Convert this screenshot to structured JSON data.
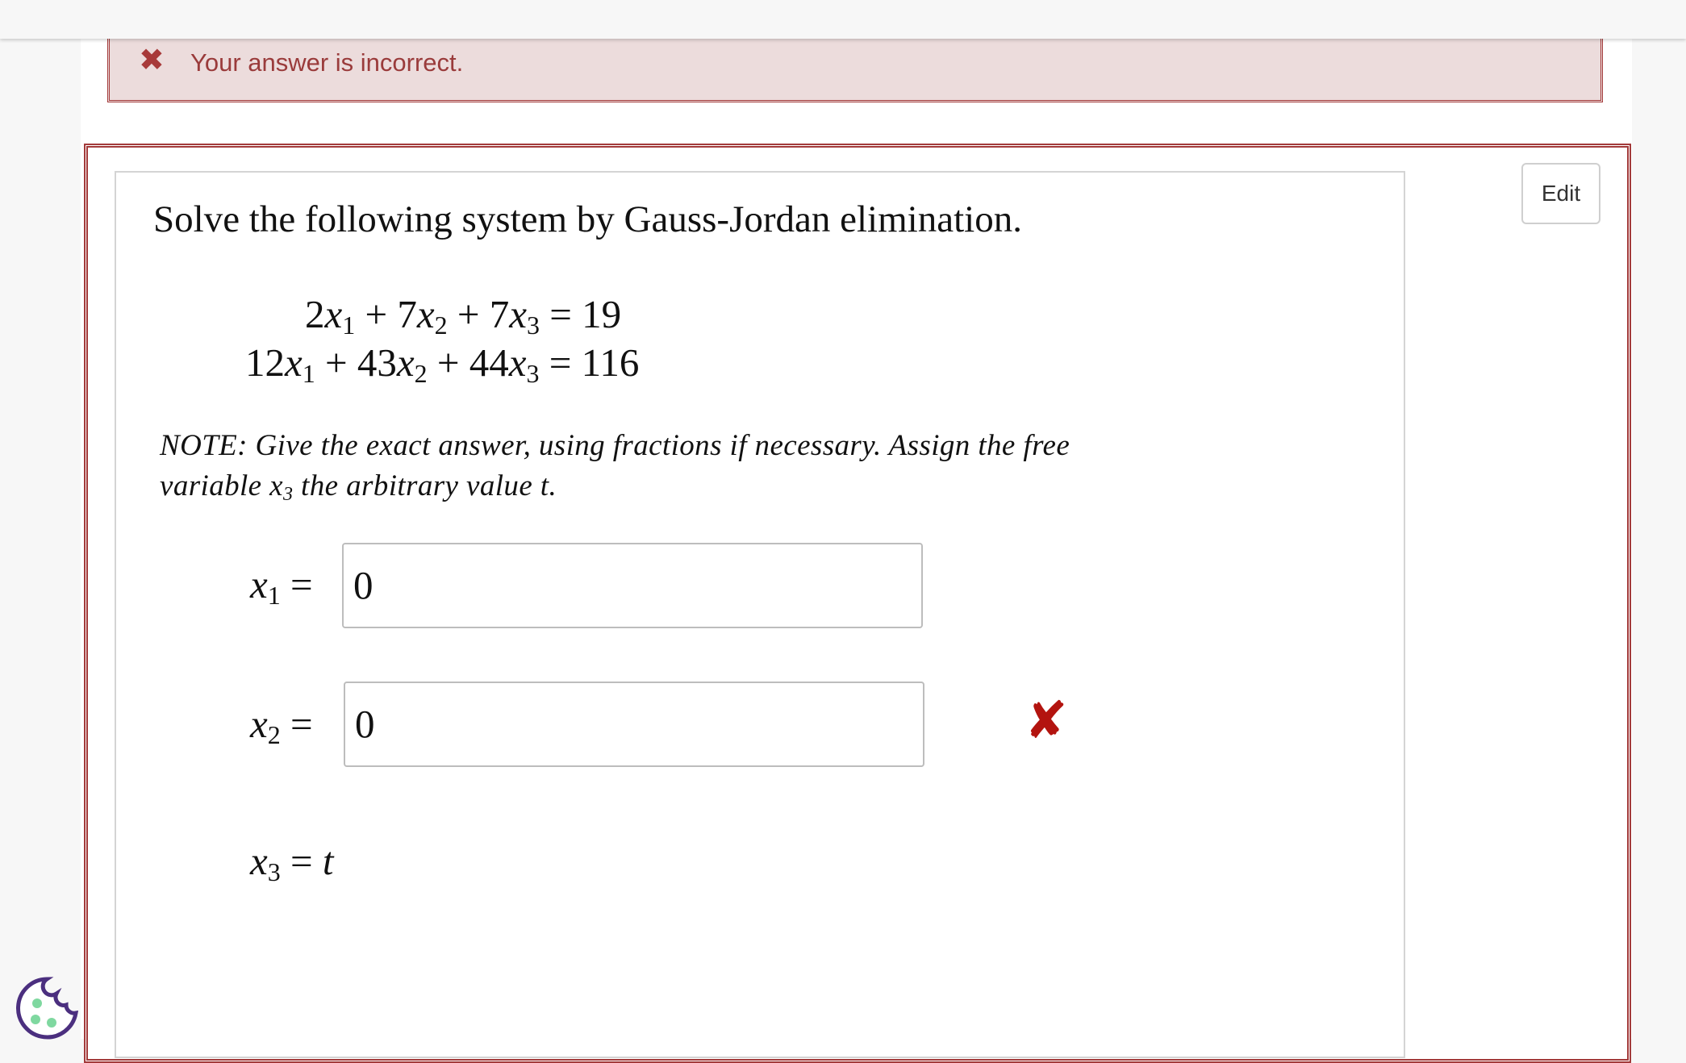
{
  "feedback": {
    "icon": "x-icon",
    "message": "Your answer is incorrect."
  },
  "question": {
    "edit_label": "Edit",
    "title": "Solve the following system by Gauss-Jordan elimination.",
    "equation_1": {
      "c1": "2",
      "c2": "7",
      "c3": "7",
      "rhs": "19"
    },
    "equation_2": {
      "c1": "12",
      "c2": "43",
      "c3": "44",
      "rhs": "116"
    },
    "note_part1": "NOTE: Give the exact answer, using fractions if necessary. Assign the free variable ",
    "note_var": "x",
    "note_sub": "3",
    "note_part2": " the arbitrary value ",
    "note_t": "t",
    "note_end": "."
  },
  "answers": {
    "x1": {
      "var": "x",
      "sub": "1",
      "value": "0"
    },
    "x2": {
      "var": "x",
      "sub": "2",
      "value": "0",
      "status": "incorrect"
    },
    "x3": {
      "var": "x",
      "sub": "3",
      "value": "t"
    }
  },
  "colors": {
    "error": "#a33a3a",
    "alert_bg": "#ecdcdc",
    "wrong_mark": "#b3140f"
  }
}
